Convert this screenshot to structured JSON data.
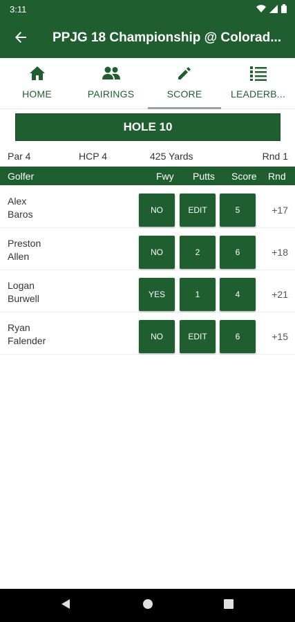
{
  "status_bar": {
    "time": "3:11"
  },
  "app_bar": {
    "title": "PPJG 18 Championship @ Colorad..."
  },
  "tabs": [
    {
      "label": "HOME",
      "icon": "home-icon"
    },
    {
      "label": "PAIRINGS",
      "icon": "people-icon"
    },
    {
      "label": "SCORE",
      "icon": "pencil-icon",
      "selected": true
    },
    {
      "label": "LEADERB...",
      "icon": "list-icon"
    }
  ],
  "hole": {
    "title": "HOLE 10",
    "par": "Par 4",
    "hcp": "HCP 4",
    "yards": "425 Yards",
    "round": "Rnd 1"
  },
  "columns": {
    "golfer": "Golfer",
    "fwy": "Fwy",
    "putts": "Putts",
    "score": "Score",
    "rnd": "Rnd"
  },
  "golfers": [
    {
      "first": "Alex",
      "last": "Baros",
      "fwy": "NO",
      "putts": "EDIT",
      "score": "5",
      "rnd": "+17"
    },
    {
      "first": "Preston",
      "last": "Allen",
      "fwy": "NO",
      "putts": "2",
      "score": "6",
      "rnd": "+18"
    },
    {
      "first": "Logan",
      "last": "Burwell",
      "fwy": "YES",
      "putts": "1",
      "score": "4",
      "rnd": "+21"
    },
    {
      "first": "Ryan",
      "last": "Falender",
      "fwy": "NO",
      "putts": "EDIT",
      "score": "6",
      "rnd": "+15"
    }
  ],
  "colors": {
    "primary": "#1f5e2e",
    "indicator": "#9aa39b"
  }
}
